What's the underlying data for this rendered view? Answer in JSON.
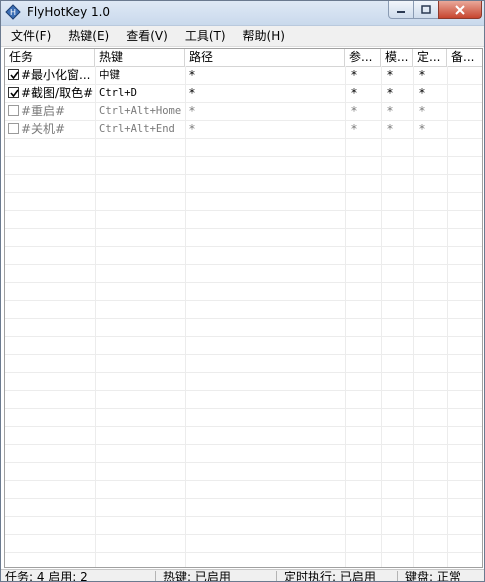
{
  "window": {
    "title": "FlyHotKey 1.0",
    "icon": "app-diamond-icon",
    "controls": [
      "minimize-icon",
      "maximize-icon",
      "close-icon"
    ]
  },
  "menu": [
    {
      "label": "文件(F)"
    },
    {
      "label": "热键(E)"
    },
    {
      "label": "查看(V)"
    },
    {
      "label": "工具(T)"
    },
    {
      "label": "帮助(H)"
    }
  ],
  "columns": [
    {
      "label": "任务"
    },
    {
      "label": "热键"
    },
    {
      "label": "路径"
    },
    {
      "label": "参..."
    },
    {
      "label": "模..."
    },
    {
      "label": "定..."
    },
    {
      "label": "备..."
    }
  ],
  "rows": [
    {
      "checked": true,
      "task": "#最小化窗...",
      "hotkey": "中键",
      "path": "*",
      "param": "*",
      "mode": "*",
      "timer": "*",
      "note": ""
    },
    {
      "checked": true,
      "task": "#截图/取色#",
      "hotkey": "Ctrl+D",
      "path": "*",
      "param": "*",
      "mode": "*",
      "timer": "*",
      "note": ""
    },
    {
      "checked": false,
      "task": "#重启#",
      "hotkey": "Ctrl+Alt+Home",
      "path": "*",
      "param": "*",
      "mode": "*",
      "timer": "*",
      "note": ""
    },
    {
      "checked": false,
      "task": "#关机#",
      "hotkey": "Ctrl+Alt+End",
      "path": "*",
      "param": "*",
      "mode": "*",
      "timer": "*",
      "note": ""
    }
  ],
  "status": {
    "tasks": "任务: 4  启用: 2",
    "hotkey": "热键: 已启用",
    "timer": "定时执行: 已启用",
    "keyboard": "键盘: 正常"
  },
  "colors": {
    "accent": "#c7452f",
    "disabled_text": "#7a7a7a"
  }
}
